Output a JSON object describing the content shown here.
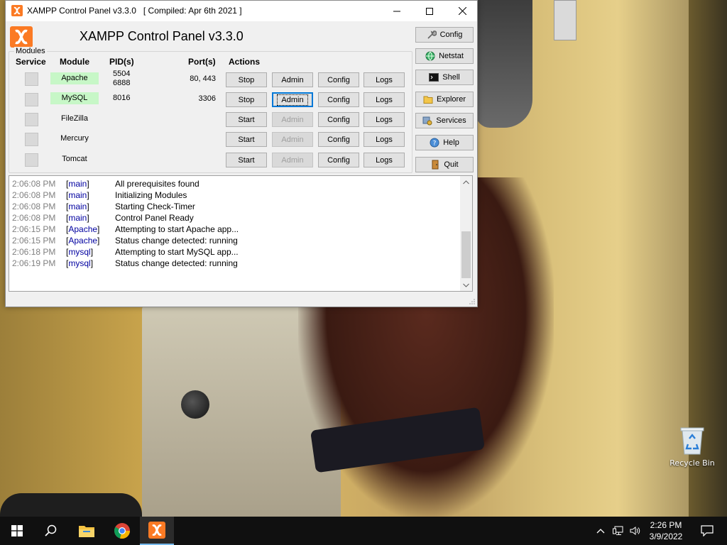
{
  "window": {
    "title": "XAMPP Control Panel v3.3.0   [ Compiled: Apr 6th 2021 ]"
  },
  "header": {
    "title": "XAMPP Control Panel v3.3.0",
    "modules_legend": "Modules"
  },
  "columns": {
    "service": "Service",
    "module": "Module",
    "pids": "PID(s)",
    "ports": "Port(s)",
    "actions": "Actions"
  },
  "modules": [
    {
      "name": "Apache",
      "pid1": "5504",
      "pid2": "6888",
      "ports": "80, 443",
      "toggle": "Stop",
      "admin": "Admin",
      "config": "Config",
      "logs": "Logs",
      "running": true
    },
    {
      "name": "MySQL",
      "pid1": "8016",
      "pid2": "",
      "ports": "3306",
      "toggle": "Stop",
      "admin": "Admin",
      "config": "Config",
      "logs": "Logs",
      "running": true
    },
    {
      "name": "FileZilla",
      "pid1": "",
      "pid2": "",
      "ports": "",
      "toggle": "Start",
      "admin": "Admin",
      "config": "Config",
      "logs": "Logs",
      "running": false
    },
    {
      "name": "Mercury",
      "pid1": "",
      "pid2": "",
      "ports": "",
      "toggle": "Start",
      "admin": "Admin",
      "config": "Config",
      "logs": "Logs",
      "running": false
    },
    {
      "name": "Tomcat",
      "pid1": "",
      "pid2": "",
      "ports": "",
      "toggle": "Start",
      "admin": "Admin",
      "config": "Config",
      "logs": "Logs",
      "running": false
    }
  ],
  "sidebar": [
    {
      "label": "Config",
      "icon": "wrench-icon"
    },
    {
      "label": "Netstat",
      "icon": "globe-icon"
    },
    {
      "label": "Shell",
      "icon": "terminal-icon"
    },
    {
      "label": "Explorer",
      "icon": "folder-icon"
    },
    {
      "label": "Services",
      "icon": "services-icon"
    },
    {
      "label": "Help",
      "icon": "help-icon"
    },
    {
      "label": "Quit",
      "icon": "door-icon"
    }
  ],
  "log": [
    {
      "time": "2:06:08 PM",
      "module": "main",
      "text": "All prerequisites found"
    },
    {
      "time": "2:06:08 PM",
      "module": "main",
      "text": "Initializing Modules"
    },
    {
      "time": "2:06:08 PM",
      "module": "main",
      "text": "Starting Check-Timer"
    },
    {
      "time": "2:06:08 PM",
      "module": "main",
      "text": "Control Panel Ready"
    },
    {
      "time": "2:06:15 PM",
      "module": "Apache",
      "text": "Attempting to start Apache app..."
    },
    {
      "time": "2:06:15 PM",
      "module": "Apache",
      "text": "Status change detected: running"
    },
    {
      "time": "2:06:18 PM",
      "module": "mysql",
      "text": "Attempting to start MySQL app..."
    },
    {
      "time": "2:06:19 PM",
      "module": "mysql",
      "text": "Status change detected: running"
    }
  ],
  "desktop": {
    "recycle_bin": "Recycle Bin"
  },
  "taskbar": {
    "time": "2:26 PM",
    "date": "3/9/2022"
  },
  "colors": {
    "xampp_orange": "#fb7a24",
    "running_green": "#c7f7c7",
    "accent": "#0078d7"
  }
}
